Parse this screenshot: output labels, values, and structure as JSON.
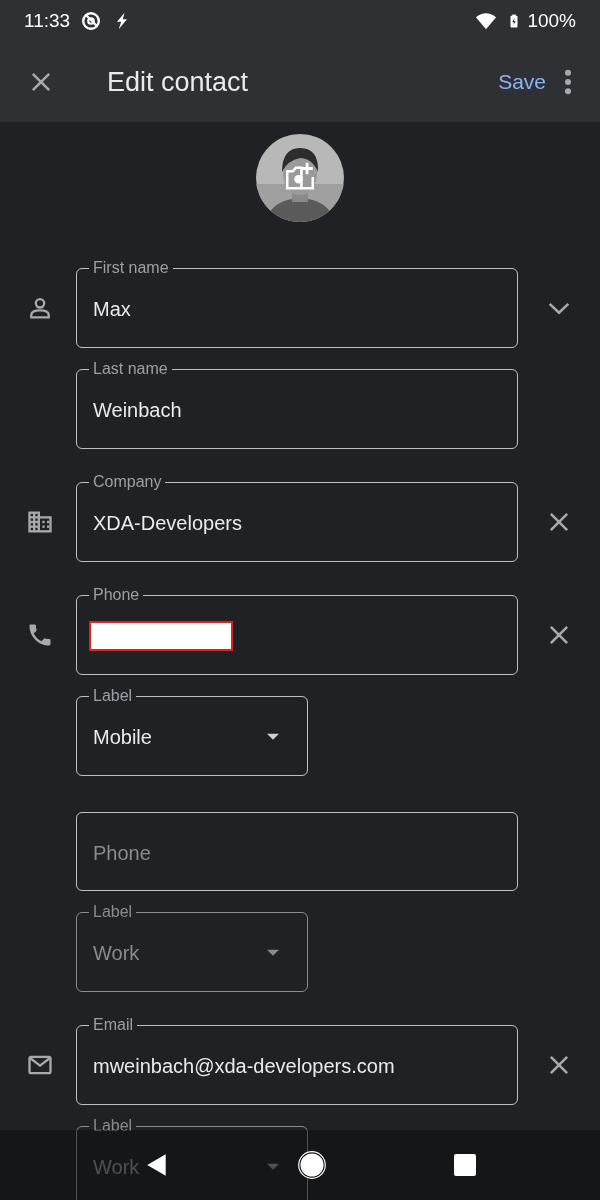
{
  "status_bar": {
    "time": "11:33",
    "battery": "100%"
  },
  "app_bar": {
    "title": "Edit contact",
    "action": "Save"
  },
  "sections": [
    {
      "kind": "name",
      "entries": [
        {
          "fields": [
            {
              "kind": "text",
              "label": "First name",
              "value": "Max"
            },
            {
              "kind": "text",
              "label": "Last name",
              "value": "Weinbach"
            }
          ]
        }
      ]
    },
    {
      "kind": "company",
      "entries": [
        {
          "fields": [
            {
              "kind": "text",
              "label": "Company",
              "value": "XDA-Developers"
            }
          ]
        }
      ]
    },
    {
      "kind": "phone",
      "entries": [
        {
          "fields": [
            {
              "kind": "text",
              "label": "Phone",
              "redacted": true
            },
            {
              "kind": "dropdown",
              "label": "Label",
              "value": "Mobile",
              "dimmed": false
            }
          ]
        },
        {
          "fields": [
            {
              "kind": "text",
              "placeholder": "Phone"
            },
            {
              "kind": "dropdown",
              "label": "Label",
              "value": "Work",
              "dimmed": true
            }
          ]
        }
      ]
    },
    {
      "kind": "email",
      "entries": [
        {
          "fields": [
            {
              "kind": "text",
              "label": "Email",
              "value": "mweinbach@xda-developers.com"
            },
            {
              "kind": "dropdown",
              "label": "Label",
              "value": "Work",
              "dimmed": true
            }
          ]
        }
      ]
    }
  ]
}
